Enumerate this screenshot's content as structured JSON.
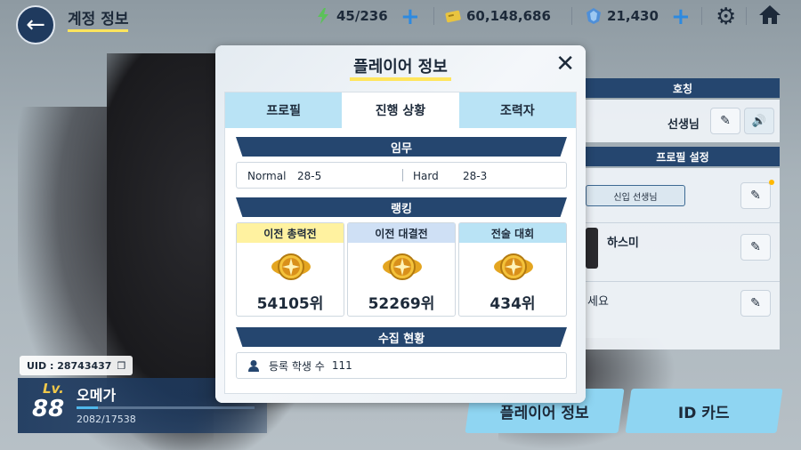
{
  "header": {
    "back_icon": "back-arrow-icon",
    "title": "계정 정보",
    "ap": "45/236",
    "credits": "60,148,686",
    "pyroxene": "21,430",
    "plus": "+"
  },
  "right_panel": {
    "nickname_head": "호칭",
    "nickname_value": "선생님",
    "profile_head": "프로필 설정",
    "title_chip": "신입 선생님",
    "student_name": "하스미",
    "comment_partial": "세요"
  },
  "bottom_buttons": {
    "player_info": "플레이어 정보",
    "id_card": "ID 카드"
  },
  "player": {
    "uid": "UID : 28743437",
    "lv_label": "Lv.",
    "level": "88",
    "name": "오메가",
    "exp": "2082/17538",
    "exp_fraction": 0.1187
  },
  "modal": {
    "title": "플레이어 정보",
    "tabs": [
      "프로필",
      "진행 상황",
      "조력자"
    ],
    "active_tab": 1,
    "mission_head": "임무",
    "normal_label": "Normal",
    "normal_value": "28-5",
    "hard_label": "Hard",
    "hard_value": "28-3",
    "ranking_head": "랭킹",
    "rankings": [
      {
        "label": "이전 총력전",
        "value": "54105위",
        "color": "#fff2a0"
      },
      {
        "label": "이전 대결전",
        "value": "52269위",
        "color": "#cfe0f5"
      },
      {
        "label": "전술 대회",
        "value": "434위",
        "color": "#b9e3f5"
      }
    ],
    "collection_head": "수집 현황",
    "students_label": "등록 학생 수",
    "students_value": "111"
  }
}
